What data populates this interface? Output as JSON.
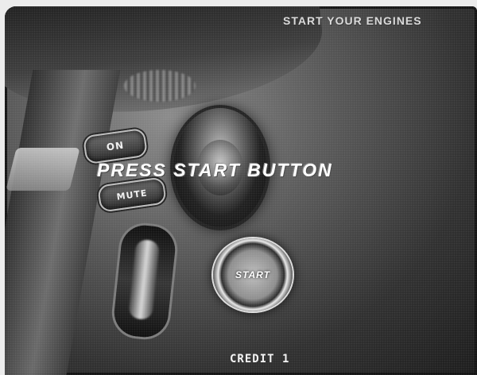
{
  "header": {
    "banner": "START YOUR ENGINES"
  },
  "main": {
    "prompt": "PRESS START BUTTON",
    "buttons": {
      "on_label": "ON",
      "mute_label": "MUTE",
      "start_label": "START"
    }
  },
  "footer": {
    "credit": "CREDIT 1"
  },
  "colors": {
    "text": "#ffffff",
    "background_dark": "#1a1a1a"
  }
}
